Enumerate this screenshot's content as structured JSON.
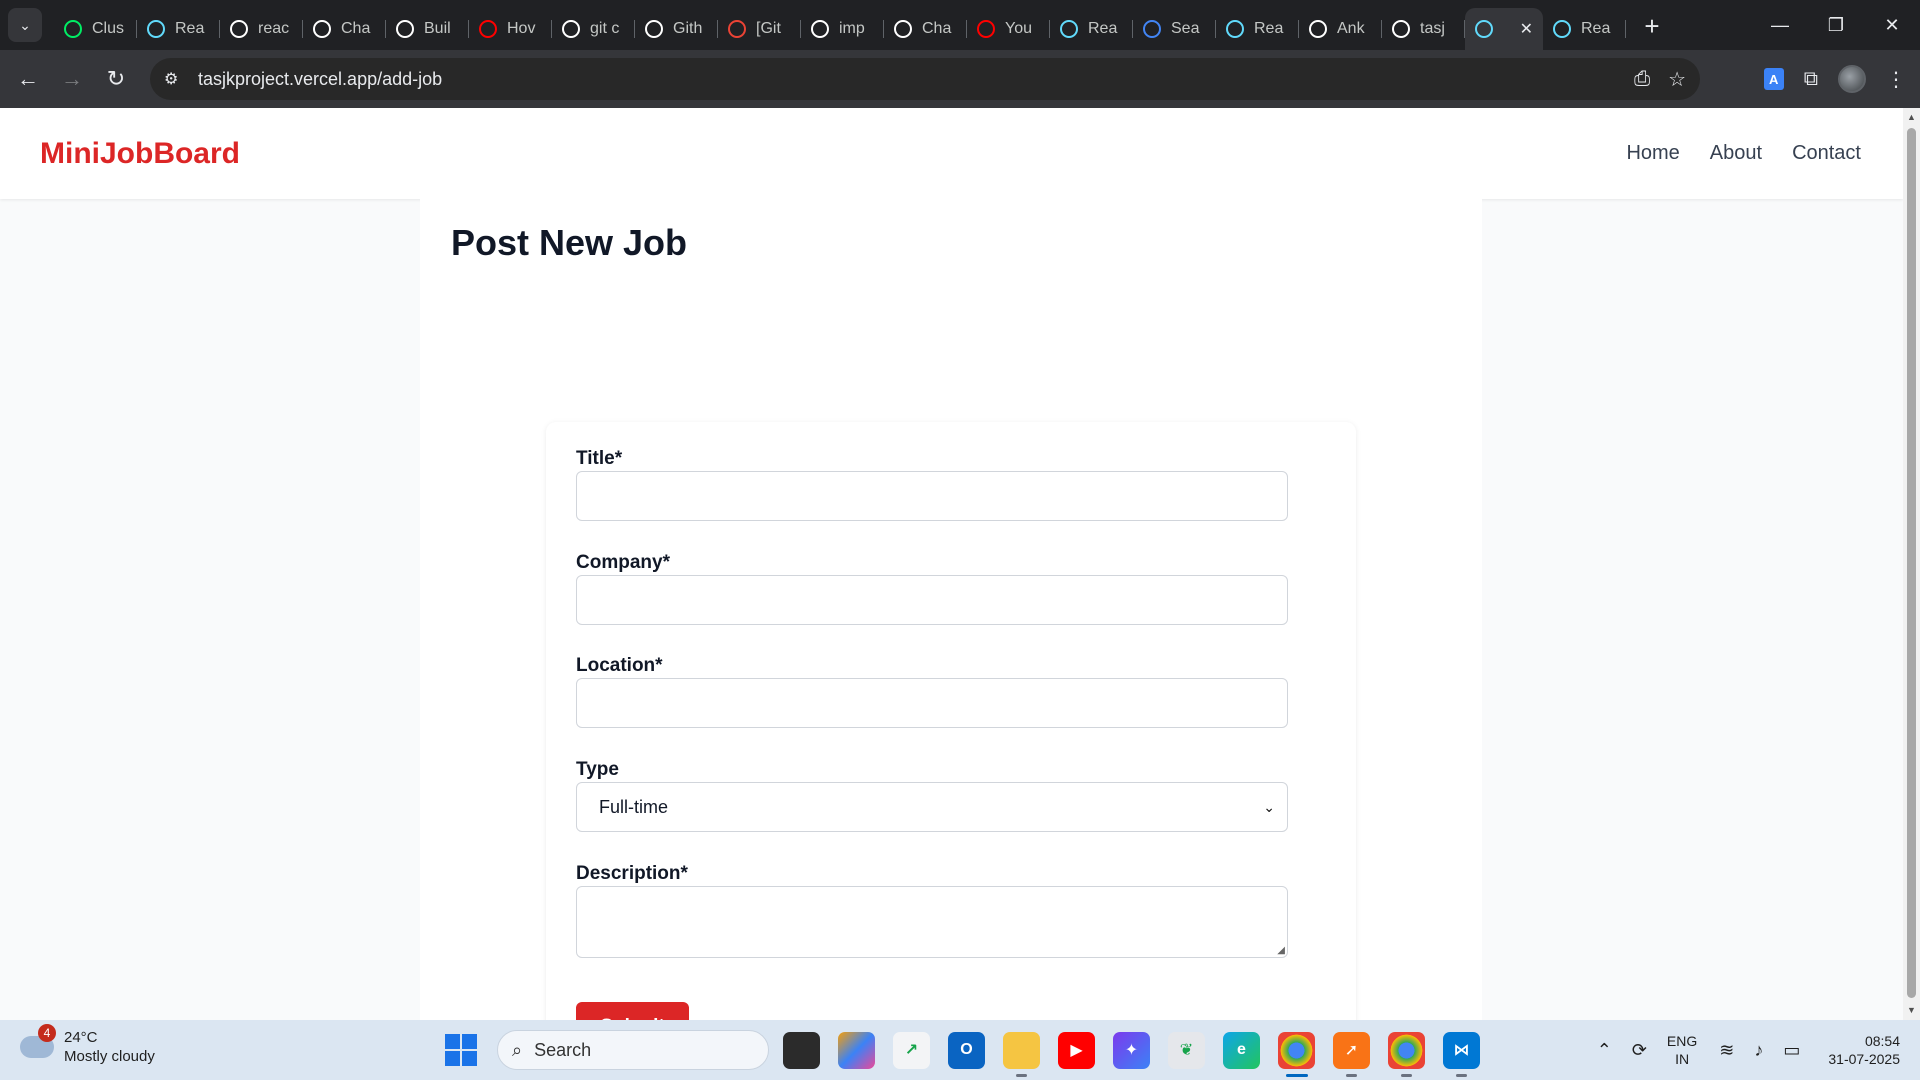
{
  "browser": {
    "tabs": [
      {
        "label": "Clus",
        "icon": "leaf-icon",
        "color": "#00ed64"
      },
      {
        "label": "Rea",
        "icon": "react-icon",
        "color": "#61dafb"
      },
      {
        "label": "reac",
        "icon": "github-icon",
        "color": "#ffffff"
      },
      {
        "label": "Cha",
        "icon": "chatgpt-icon",
        "color": "#ffffff"
      },
      {
        "label": "Buil",
        "icon": "tool-icon",
        "color": "#ffffff"
      },
      {
        "label": "Hov",
        "icon": "youtube-icon",
        "color": "#ff0000"
      },
      {
        "label": "git c",
        "icon": "google-icon",
        "color": "#ffffff"
      },
      {
        "label": "Gith",
        "icon": "github-icon",
        "color": "#ffffff"
      },
      {
        "label": "[Git",
        "icon": "gmail-icon",
        "color": "#ea4335"
      },
      {
        "label": "imp",
        "icon": "google-icon",
        "color": "#ffffff"
      },
      {
        "label": "Cha",
        "icon": "chatgpt-icon",
        "color": "#ffffff"
      },
      {
        "label": "You",
        "icon": "youtube-icon",
        "color": "#ff0000"
      },
      {
        "label": "Rea",
        "icon": "react-icon",
        "color": "#61dafb"
      },
      {
        "label": "Sea",
        "icon": "search-icon",
        "color": "#4285f4"
      },
      {
        "label": "Rea",
        "icon": "react-icon",
        "color": "#61dafb"
      },
      {
        "label": "Ank",
        "icon": "github-icon",
        "color": "#ffffff"
      },
      {
        "label": "tasj",
        "icon": "vercel-icon",
        "color": "#ffffff"
      },
      {
        "label": "",
        "icon": "react-icon",
        "color": "#61dafb",
        "active": true
      },
      {
        "label": "Rea",
        "icon": "react-icon",
        "color": "#61dafb"
      }
    ],
    "url": "tasjkproject.vercel.app/add-job"
  },
  "site": {
    "brand": "MiniJobBoard",
    "brand_color": "#dc2626",
    "nav": [
      "Home",
      "About",
      "Contact"
    ]
  },
  "page": {
    "title": "Post New Job",
    "form": {
      "title_label": "Title*",
      "title_value": "",
      "company_label": "Company*",
      "company_value": "",
      "location_label": "Location*",
      "location_value": "",
      "type_label": "Type",
      "type_value": "Full-time",
      "description_label": "Description*",
      "description_value": "",
      "submit_label": "Submit"
    }
  },
  "taskbar": {
    "weather_temp": "24°C",
    "weather_desc": "Mostly cloudy",
    "weather_badge": "4",
    "search_label": "Search",
    "lang_top": "ENG",
    "lang_bottom": "IN",
    "time": "08:54",
    "date": "31-07-2025"
  }
}
